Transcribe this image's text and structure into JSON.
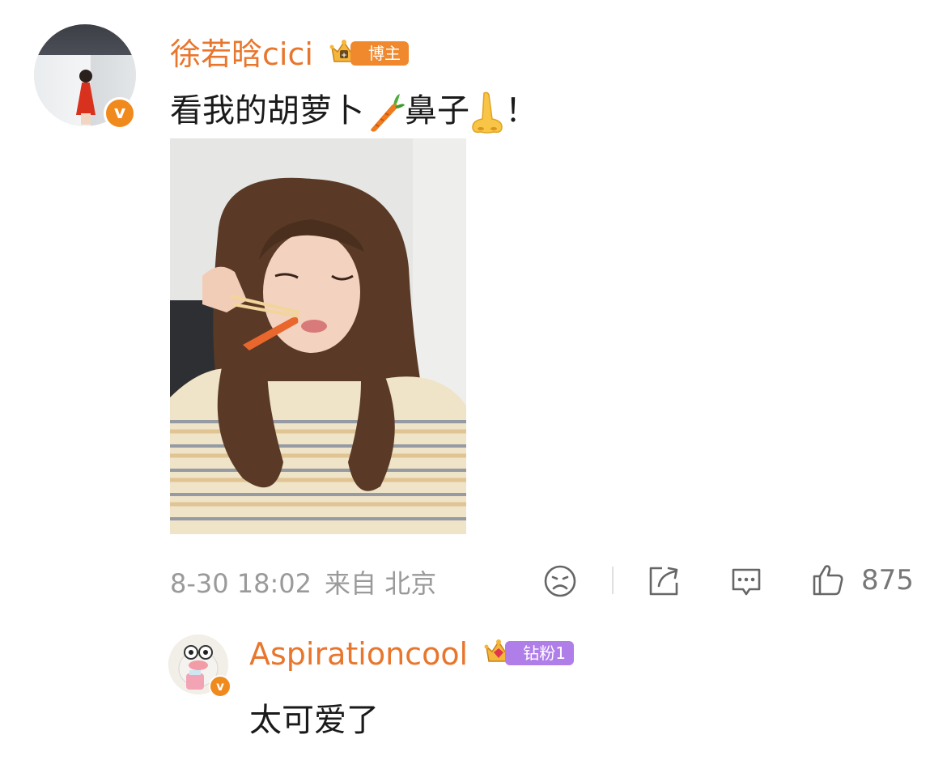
{
  "post": {
    "username": "徐若晗cici",
    "badge_label": "博主",
    "text": "看我的胡萝卜",
    "text_part2": "鼻子",
    "text_end": "！",
    "emojis": [
      "carrot-icon",
      "nose-icon"
    ],
    "timestamp": "8-30 18:02",
    "source": "来自 北京",
    "like_count": "875"
  },
  "reply": {
    "username": "Aspirationcool",
    "badge_label": "钻粉1",
    "text": "太可爱了"
  },
  "colors": {
    "username": "#e8762d",
    "verified_badge": "#f08a1c",
    "blogger_badge": "#f0892e",
    "fan_badge": "#b07ee8",
    "meta_text": "#9a9a9a"
  }
}
